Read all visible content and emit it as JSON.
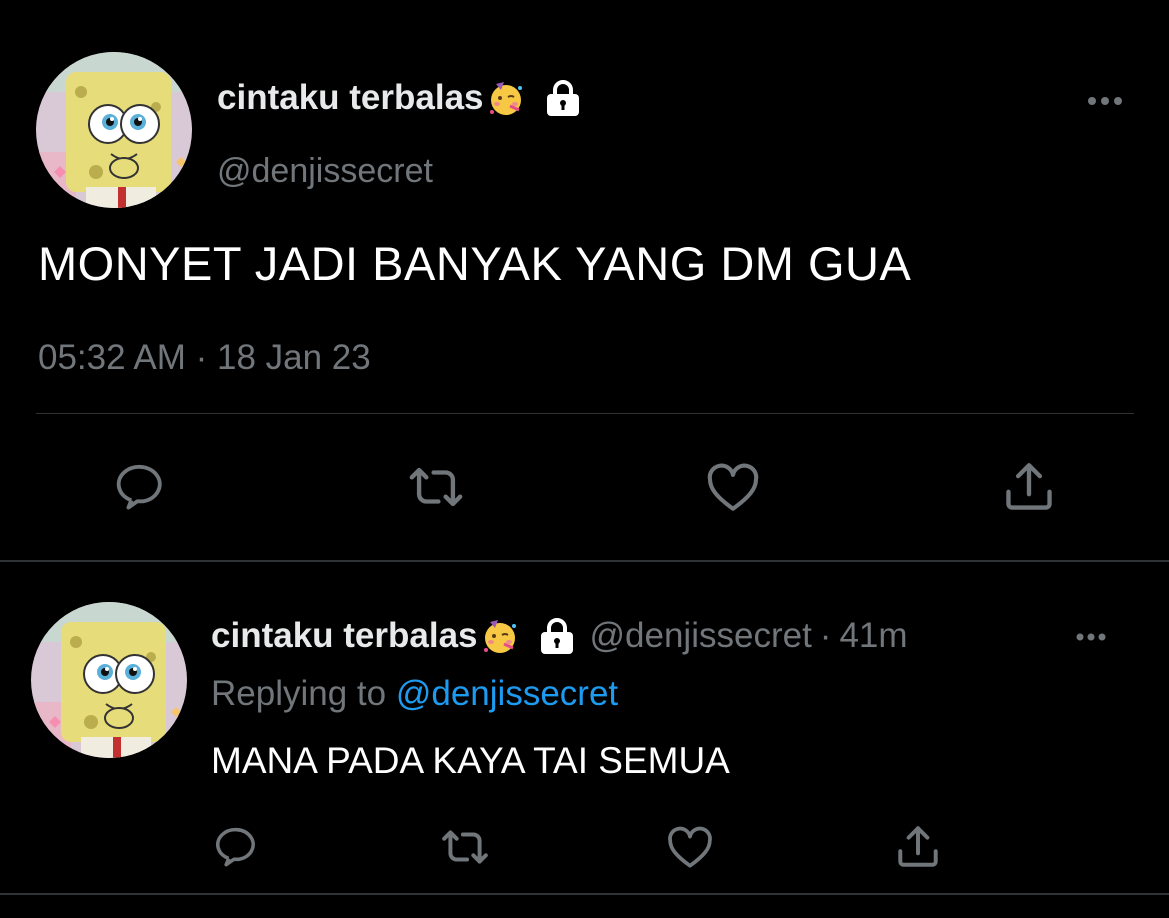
{
  "main_tweet": {
    "display_name": "cintaku terbalas",
    "name_emoji_icon": "partying-face-emoji",
    "protected_icon": "lock-icon",
    "handle": "@denjissecret",
    "text": "MONYET JADI BANYAK YANG DM GUA",
    "timestamp": "05:32 AM · 18 Jan 23",
    "actions": [
      "reply-icon",
      "retweet-icon",
      "like-icon",
      "share-icon"
    ]
  },
  "reply_tweet": {
    "display_name": "cintaku terbalas",
    "name_emoji_icon": "partying-face-emoji",
    "protected_icon": "lock-icon",
    "handle": "@denjissecret",
    "separator": "·",
    "age": "41m",
    "replying_prefix": "Replying to",
    "replying_to": "@denjissecret",
    "text": "MANA PADA KAYA TAI SEMUA",
    "actions": [
      "reply-icon",
      "retweet-icon",
      "like-icon",
      "share-icon"
    ]
  },
  "colors": {
    "background": "#000000",
    "primary_text": "#e7e9ea",
    "secondary_text": "#71767b",
    "link": "#1d9bf0",
    "divider": "#2f3336"
  }
}
